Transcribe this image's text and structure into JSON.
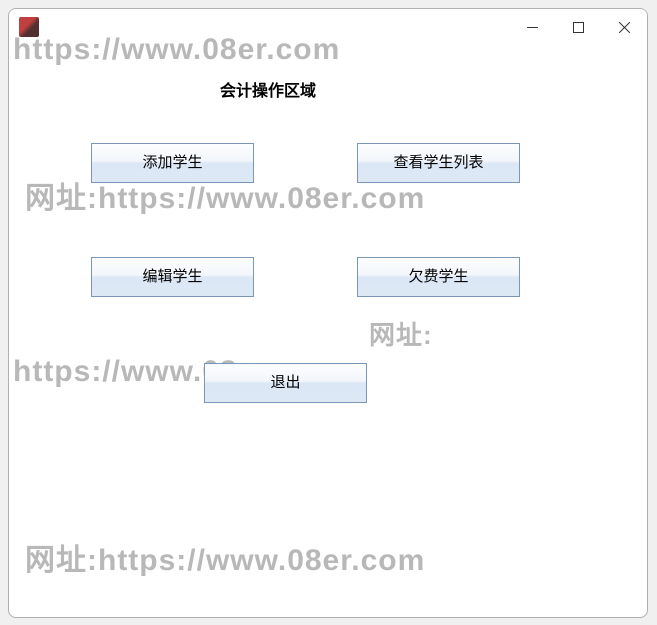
{
  "window": {
    "title": "",
    "page_title": "会计操作区域"
  },
  "buttons": {
    "add_student": "添加学生",
    "view_list": "查看学生列表",
    "edit_student": "编辑学生",
    "owed_student": "欠费学生",
    "exit": "退出"
  },
  "watermarks": {
    "url": "https://www.08er.com",
    "label_url": "网址:https://www.08er.com",
    "label": "网址:"
  }
}
